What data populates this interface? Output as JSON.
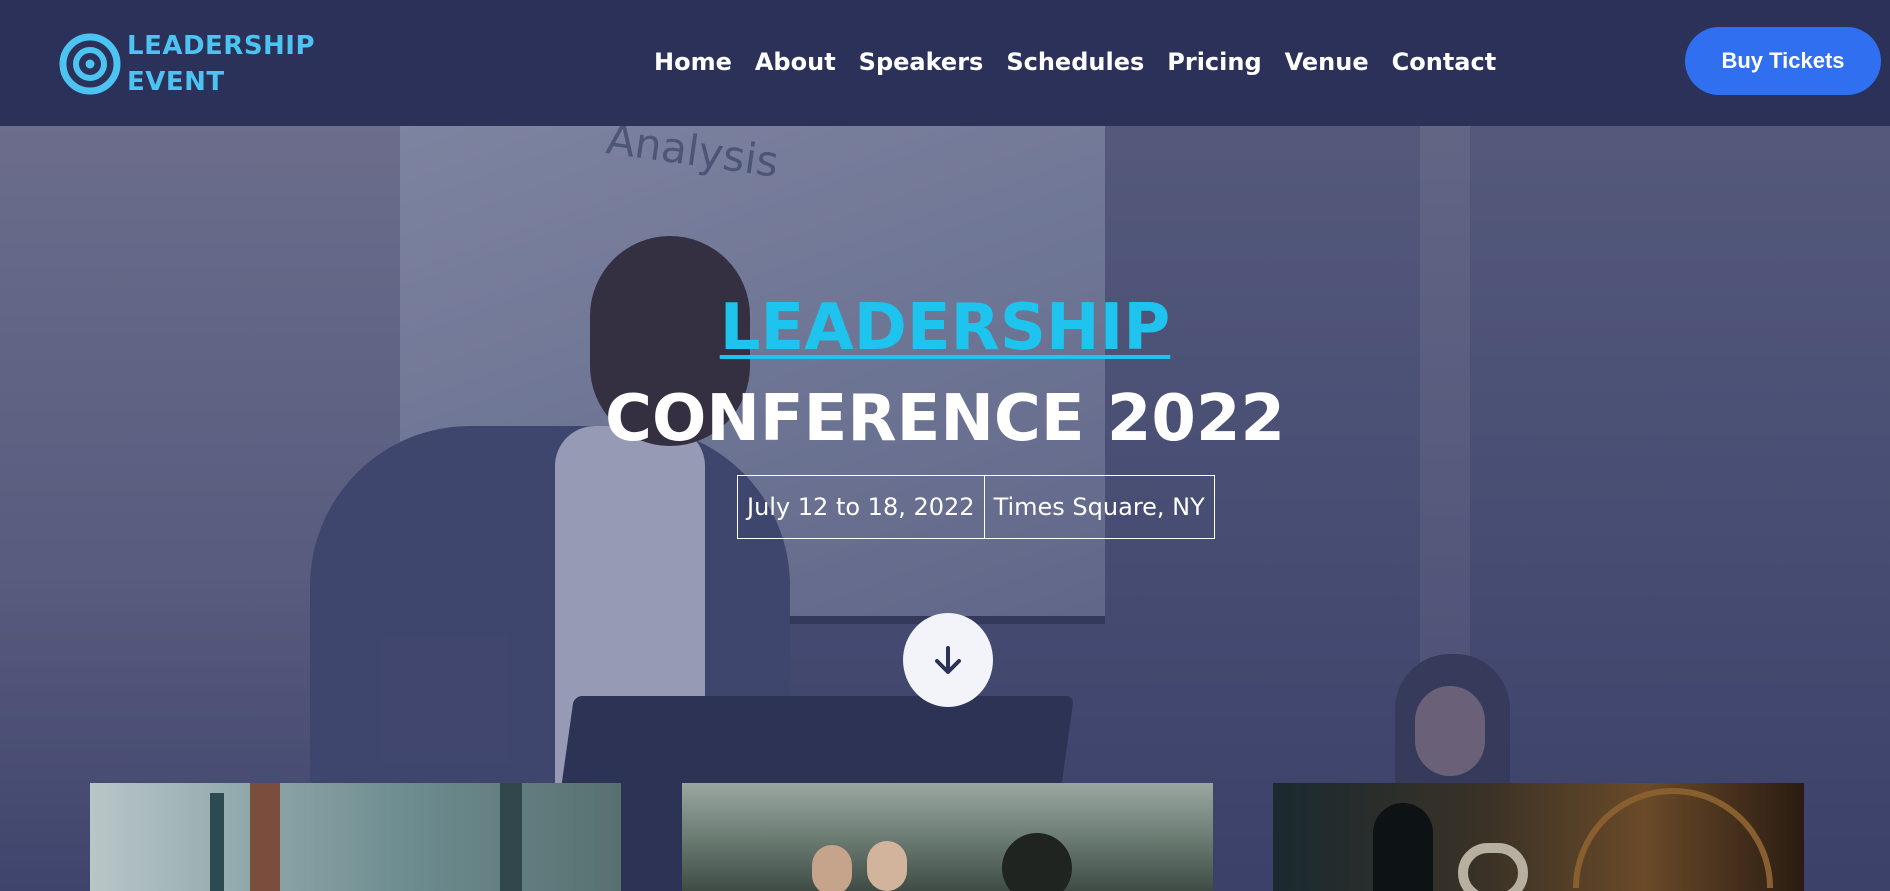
{
  "header": {
    "logo": {
      "line1": "LEADERSHIP",
      "line2": "EVENT",
      "icon": "target-icon"
    },
    "nav": [
      {
        "label": "Home"
      },
      {
        "label": "About"
      },
      {
        "label": "Speakers"
      },
      {
        "label": "Schedules"
      },
      {
        "label": "Pricing"
      },
      {
        "label": "Venue"
      },
      {
        "label": "Contact"
      }
    ],
    "buy_button": "Buy Tickets"
  },
  "hero": {
    "title_highlight": "LEADERSHIP",
    "title_main": "CONFERENCE 2022",
    "dates": "July 12 to 18, 2022",
    "location": "Times Square, NY",
    "scroll_icon": "arrow-down-icon",
    "screen_text": "Analysis"
  },
  "colors": {
    "header_bg": "#2b3158",
    "accent": "#4cc3f1",
    "title_accent": "#1ec3ee",
    "button": "#2f6ff0"
  }
}
